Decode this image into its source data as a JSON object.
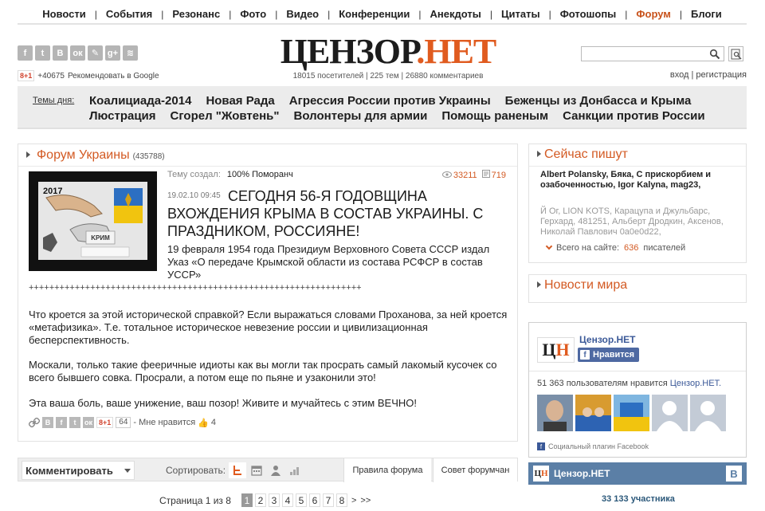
{
  "nav": {
    "items": [
      {
        "label": "Новости"
      },
      {
        "label": "События"
      },
      {
        "label": "Резонанс"
      },
      {
        "label": "Фото"
      },
      {
        "label": "Видео"
      },
      {
        "label": "Конференции"
      },
      {
        "label": "Анекдоты"
      },
      {
        "label": "Цитаты"
      },
      {
        "label": "Фотошопы"
      },
      {
        "label": "Форум",
        "active": true
      },
      {
        "label": "Блоги"
      }
    ],
    "separator": "|"
  },
  "header": {
    "social_icons": [
      "facebook-icon",
      "twitter-icon",
      "vk-icon",
      "odnoklassniki-icon",
      "livejournal-icon",
      "google-plus-icon",
      "rss-icon"
    ],
    "social_glyphs": [
      "f",
      "t",
      "B",
      "ок",
      "✎",
      "g+",
      "≋"
    ],
    "gplus_label": "8+1",
    "gplus_count": "+40675",
    "recommend_text": "Рекомендовать в Google",
    "logo_part1": "ЦЕНЗОР",
    "logo_dot": ".",
    "logo_part2": "НЕТ",
    "stats": "18015 посетителей | 225 тем | 26880 комментариев",
    "search_placeholder": "",
    "login": "вход",
    "auth_sep": "|",
    "register": "регистрация"
  },
  "topics": {
    "label": "Темы дня:",
    "row1": [
      "Коалициада-2014",
      "Новая Рада",
      "Агрессия России против Украины",
      "Беженцы из Донбасса и Крыма"
    ],
    "row2": [
      "Люстрация",
      "Сгорел \"Жовтень\"",
      "Волонтеры для армии",
      "Помощь раненым",
      "Санкции против России"
    ]
  },
  "forum": {
    "title": "Форум Украины",
    "count": "(435788)",
    "thumb_year": "2017",
    "creator_label": "Тему создал:",
    "creator_name": "100% Поморанч",
    "views": "33211",
    "comments": "719",
    "datetime": "19.02.10 09:45",
    "headline": "СЕГОДНЯ 56-Я ГОДОВЩИНА ВХОЖДЕНИЯ КРЫМА В СОСТАВ УКРАИНЫ. С ПРАЗДНИКОМ, РОССИЯНЕ!",
    "lead": "19 февраля 1954 года Президиум Верховного Совета СССР издал Указ «О передаче Крымской области из состава РСФСР в состав УССР»",
    "plusline": "+++++++++++++++++++++++++++++++++++++++++++++++++++++++++++++++++",
    "p1": "Что кроется за этой исторической справкой? Если выражаться словами Проханова, за ней кроется «метафизика». Т.е. тотальное историческое невезение россии и цивилизационная бесперспективность.",
    "p2": "Москали, только такие фееричные идиоты как вы могли так просрать самый лакомый кусочек со всего бывшего совка. Просрали, а потом еще по пьяне и узаконили это!",
    "p3": "Эта ваша боль, ваше унижение, ваш позор! Живите и мучайтесь с этим ВЕЧНО!",
    "share": {
      "gplus": "8+1",
      "gplus_count": "64",
      "like_text": "- Мне нравится",
      "like_count": "4"
    }
  },
  "comments_bar": {
    "comment_button": "Комментировать",
    "sort_label": "Сортировать:",
    "rules_button": "Правила форума",
    "advice_button": "Совет форумчан"
  },
  "pager": {
    "text": "Страница 1 из 8",
    "pages": [
      "1",
      "2",
      "3",
      "4",
      "5",
      "6",
      "7",
      "8"
    ],
    "current": "1",
    "next": ">",
    "last": ">>"
  },
  "sidebar": {
    "now_title": "Сейчас пишут",
    "writers": "Albert Polansky, Бяка, С прискорбием и озабоченностью, Igor Kalyna, mag23,",
    "guests": "Й Ог, LION KOTS, Карацупа и Джульбарс, Герхард, 481251, Альберт Дродкин, Аксенов, Николай Павлович 0a0e0d22,",
    "online_label": "Всего на сайте:",
    "online_count": "636",
    "online_suffix": "писателей",
    "news_title": "Новости мира"
  },
  "facebook": {
    "logo_c": "Ц",
    "logo_h": "Н",
    "name": "Цензор.НЕТ",
    "like_button": "Нравится",
    "count_text": "51 363 пользователям нравится",
    "count_link": "Цензор.НЕТ.",
    "plugin_text": "Социальный плагин Facebook"
  },
  "vk": {
    "logo_c": "Ц",
    "logo_h": "Н",
    "name": "Цензор.НЕТ",
    "badge": "B",
    "members": "33 133 участника"
  },
  "colors": {
    "accent": "#d35a23",
    "logo_orange": "#e05b1f",
    "fb_blue": "#4e69a2",
    "vk_blue": "#5b7fa6"
  }
}
